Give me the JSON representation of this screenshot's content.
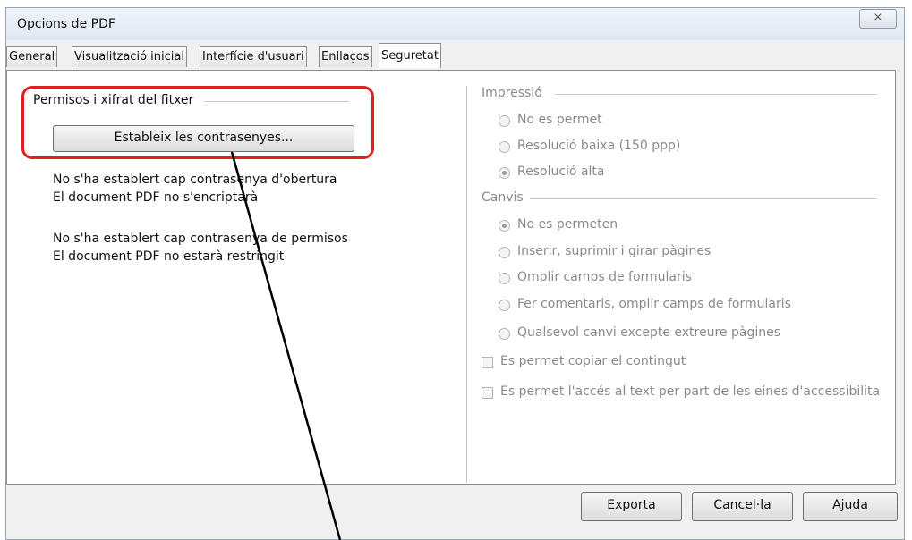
{
  "window": {
    "title": "Opcions de PDF",
    "close_symbol": "⨯"
  },
  "tabs": [
    "General",
    "Visualització inicial",
    "Interfície d'usuari",
    "Enllaços",
    "Seguretat"
  ],
  "left": {
    "group_label": "Permisos i xifrat del fitxer",
    "set_passwords_button": "Estableix les contrasenyes...",
    "status1_line1": "No s'ha establert cap contrasenya d'obertura",
    "status1_line2": "El document PDF no s'encriptarà",
    "status2_line1": "No s'ha establert cap contrasenya de permisos",
    "status2_line2": "El document PDF no estarà restringit"
  },
  "right": {
    "printing_label": "Impressió",
    "printing_options": [
      "No es permet",
      "Resolució baixa (150 ppp)",
      "Resolució alta"
    ],
    "printing_selected": "Resolució alta",
    "changes_label": "Canvis",
    "changes_options": [
      "No es permeten",
      "Inserir, suprimir i girar pàgines",
      "Omplir camps de formularis",
      "Fer comentaris, omplir camps de formularis",
      "Qualsevol canvi excepte extreure pàgines"
    ],
    "changes_selected": "No es permeten",
    "check_copy": "Es permet copiar el contingut",
    "check_access": "Es permet l'accés al text per part de les eines d'accessibilita"
  },
  "footer": {
    "export": "Exporta",
    "cancel": "Cancel·la",
    "help": "Ajuda"
  },
  "annotation_color": "#e0201c"
}
